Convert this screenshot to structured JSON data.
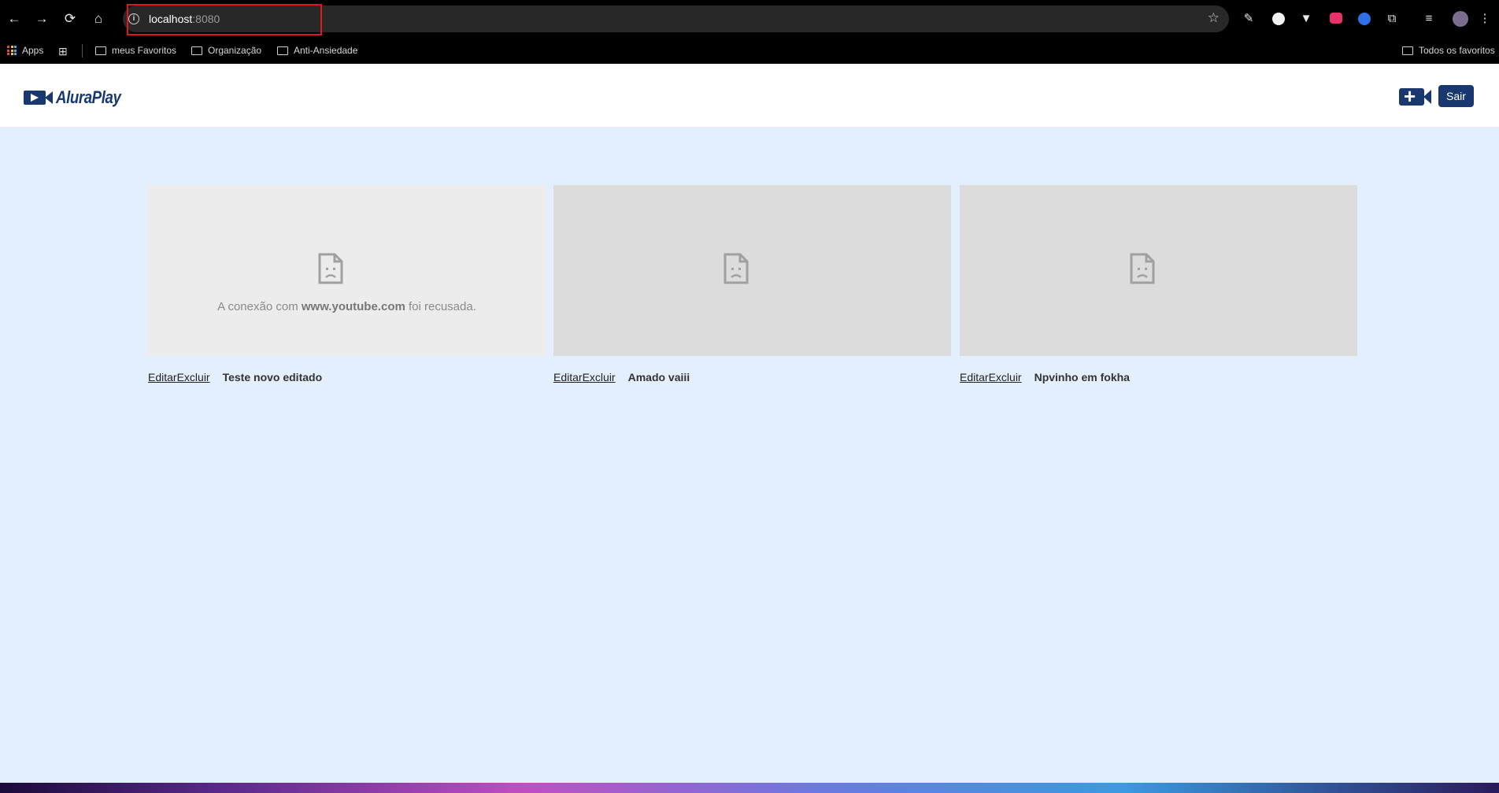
{
  "browser": {
    "url_host": "localhost",
    "url_port": ":8080",
    "bookmarks": {
      "apps": "Apps",
      "items": [
        "meus Favoritos",
        "Organização",
        "Anti-Ansiedade"
      ],
      "all": "Todos os favoritos"
    }
  },
  "header": {
    "logo": "AluraPlay",
    "logout_label": "Sair"
  },
  "videos": [
    {
      "edit_label": "Editar",
      "delete_label": "Excluir",
      "title": "Teste novo editado",
      "error_prefix": "A conexão com ",
      "error_domain": "www.youtube.com",
      "error_suffix": " foi recusada."
    },
    {
      "edit_label": "Editar",
      "delete_label": "Excluir",
      "title": "Amado vaiii"
    },
    {
      "edit_label": "Editar",
      "delete_label": "Excluir",
      "title": "Npvinho em fokha"
    }
  ]
}
